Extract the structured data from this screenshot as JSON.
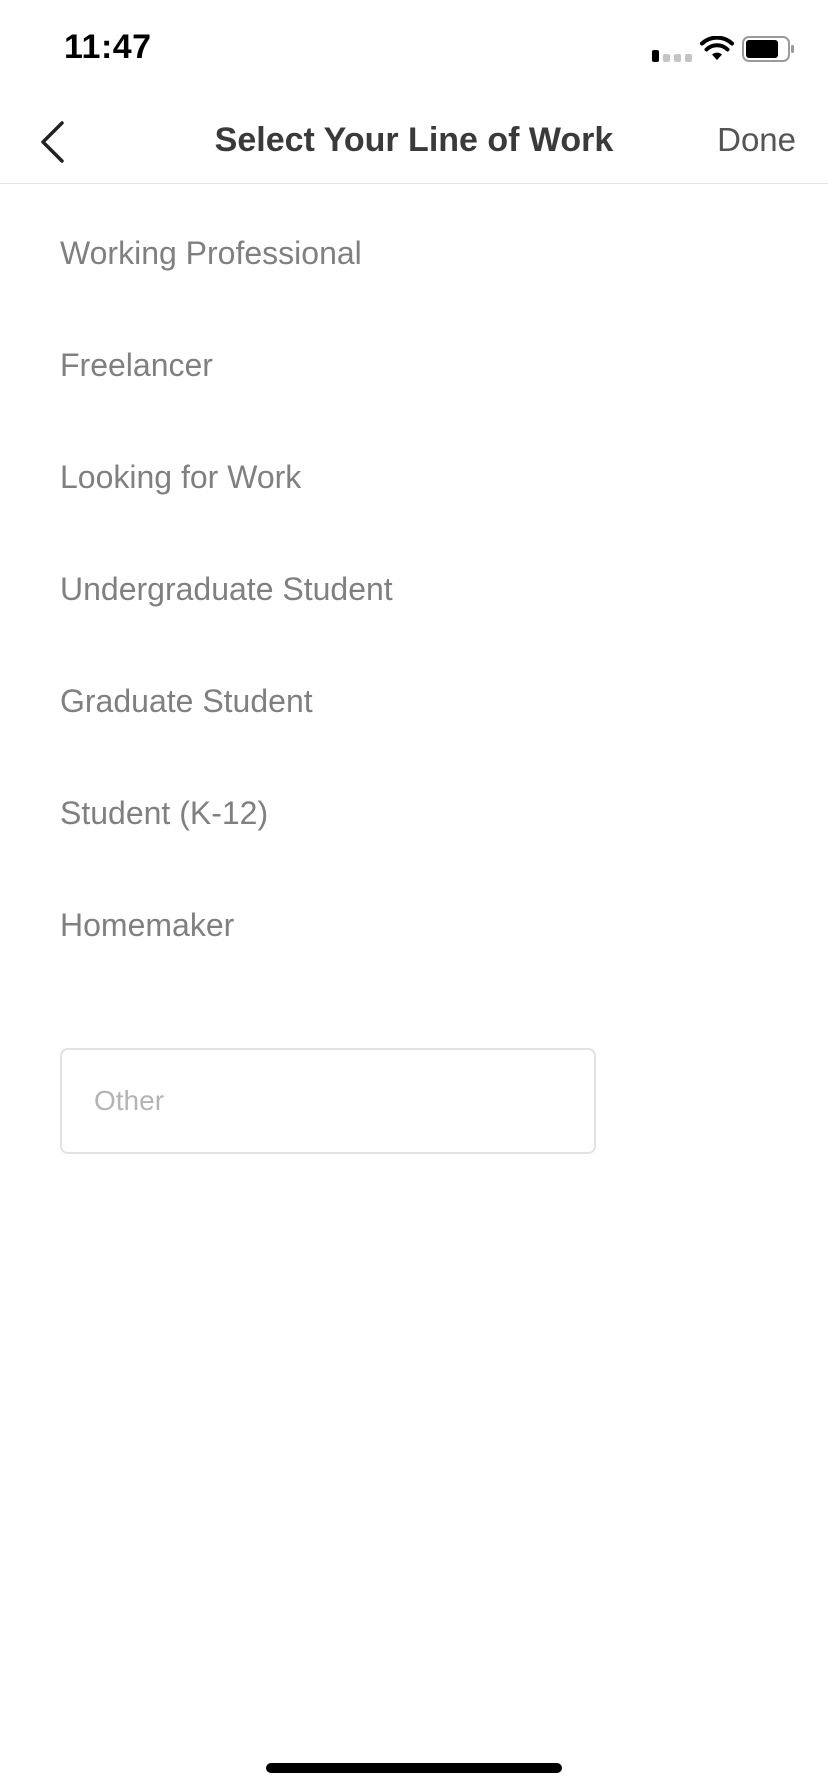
{
  "status_bar": {
    "time": "11:47"
  },
  "nav": {
    "title": "Select Your Line of Work",
    "done_label": "Done",
    "back_icon": "chevron-left-icon"
  },
  "options": [
    {
      "label": "Working Professional"
    },
    {
      "label": "Freelancer"
    },
    {
      "label": "Looking for Work"
    },
    {
      "label": "Undergraduate Student"
    },
    {
      "label": "Graduate Student"
    },
    {
      "label": "Student (K-12)"
    },
    {
      "label": "Homemaker"
    }
  ],
  "other_input": {
    "placeholder": "Other",
    "value": ""
  },
  "colors": {
    "title": "#3a3a3a",
    "option_text": "#808080",
    "divider": "#e3e3e3",
    "input_border": "#e2e2e2",
    "placeholder": "#b4b4b4"
  }
}
